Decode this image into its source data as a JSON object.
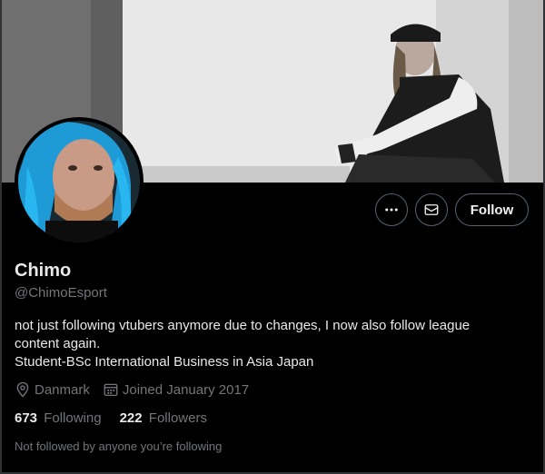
{
  "profile": {
    "name": "Chimo",
    "handle": "@ChimoEsport",
    "bio_line1": "not just following vtubers anymore due to changes, I now also follow league",
    "bio_line2": "content again.",
    "bio_line3": "Student-BSc International Business in Asia Japan",
    "location": "Danmark",
    "joined": "Joined January 2017"
  },
  "stats": {
    "following_count": "673",
    "following_label": "Following",
    "followers_count": "222",
    "followers_label": "Followers"
  },
  "actions": {
    "follow_label": "Follow",
    "more_icon": "more-horizontal-icon",
    "message_icon": "envelope-icon"
  },
  "social_context": "Not followed by anyone you’re following",
  "icons": {
    "location": "location-pin-icon",
    "calendar": "calendar-icon"
  },
  "colors": {
    "background": "#000000",
    "primary_text": "#e7e9ea",
    "secondary_text": "#71767b",
    "border": "#536471"
  }
}
